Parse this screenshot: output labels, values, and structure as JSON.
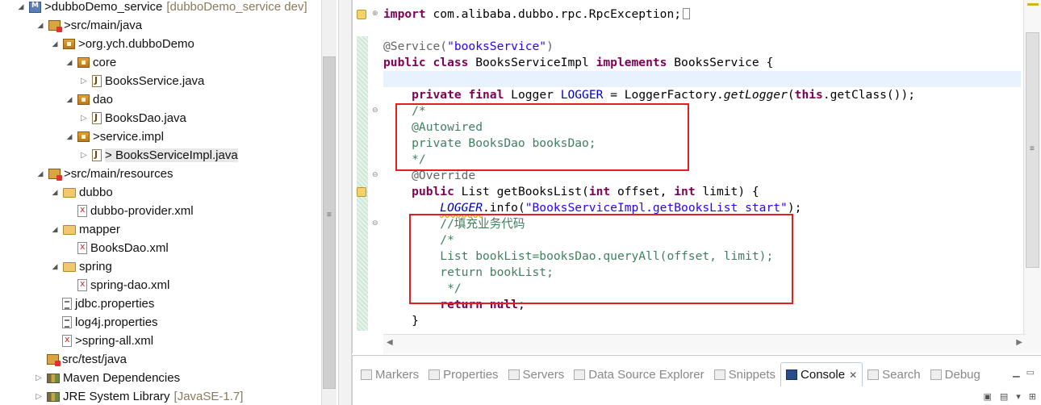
{
  "explorer": {
    "rows": [
      {
        "label": "dubboDemo_service",
        "prefix": "> ",
        "suffix": "[dubboDemo_service dev]",
        "icon": "project-icon",
        "expanded": true
      },
      {
        "label": "src/main/java",
        "prefix": "> ",
        "icon": "source-folder-icon",
        "expanded": true
      },
      {
        "label": "org.ych.dubboDemo",
        "prefix": "> ",
        "icon": "package-icon",
        "expanded": true
      },
      {
        "label": "core",
        "prefix": "",
        "icon": "package-icon",
        "expanded": true
      },
      {
        "label": "BooksService.java",
        "prefix": "",
        "icon": "java-file-icon",
        "expanded": false
      },
      {
        "label": "dao",
        "prefix": "",
        "icon": "package-icon",
        "expanded": true
      },
      {
        "label": "BooksDao.java",
        "prefix": "",
        "icon": "java-file-icon",
        "expanded": false
      },
      {
        "label": "service.impl",
        "prefix": "> ",
        "icon": "package-icon",
        "expanded": true
      },
      {
        "label": "BooksServiceImpl.java",
        "prefix": "> ",
        "icon": "java-file-icon",
        "expanded": false
      },
      {
        "label": "src/main/resources",
        "prefix": "> ",
        "icon": "source-folder-icon",
        "expanded": true
      },
      {
        "label": "dubbo",
        "prefix": "",
        "icon": "folder-icon",
        "expanded": true
      },
      {
        "label": "dubbo-provider.xml",
        "prefix": "",
        "icon": "xml-file-icon"
      },
      {
        "label": "mapper",
        "prefix": "",
        "icon": "folder-icon",
        "expanded": true
      },
      {
        "label": "BooksDao.xml",
        "prefix": "",
        "icon": "xml-file-icon"
      },
      {
        "label": "spring",
        "prefix": "",
        "icon": "folder-icon",
        "expanded": true
      },
      {
        "label": "spring-dao.xml",
        "prefix": "",
        "icon": "xml-file-icon"
      },
      {
        "label": "jdbc.properties",
        "prefix": "",
        "icon": "properties-file-icon"
      },
      {
        "label": "log4j.properties",
        "prefix": "",
        "icon": "properties-file-icon"
      },
      {
        "label": "spring-all.xml",
        "prefix": "> ",
        "icon": "xml-file-icon"
      },
      {
        "label": "src/test/java",
        "prefix": "",
        "icon": "source-folder-icon"
      },
      {
        "label": "Maven Dependencies",
        "prefix": "",
        "icon": "library-icon",
        "expanded": false
      },
      {
        "label": "JRE System Library",
        "prefix": "",
        "suffix": "[JavaSE-1.7]",
        "icon": "library-icon",
        "expanded": false
      }
    ]
  },
  "editor": {
    "lines": [
      {
        "import_kw": "import",
        "import_rest": " com.alibaba.dubbo.rpc.RpcException;"
      },
      {},
      {
        "ann": "@Service(",
        "str": "\"booksService\"",
        "ann2": ")"
      },
      {
        "kw1": "public class",
        "t1": " BooksServiceImpl ",
        "kw2": "implements",
        "t2": " BooksService {"
      },
      {},
      {
        "indent": "    ",
        "kw": "private final",
        "t1": " Logger ",
        "fld": "LOGGER",
        "t2": " = LoggerFactory.",
        "it": "getLogger",
        "t3": "(",
        "kw2": "this",
        "t4": ".getClass());"
      },
      {
        "cm": "    /*"
      },
      {
        "cm": "    @Autowired"
      },
      {
        "cm": "    private BooksDao booksDao;"
      },
      {
        "cm": "    */"
      },
      {
        "ann": "    @Override"
      },
      {
        "indent": "    ",
        "kw": "public",
        "t1": " List getBooksList(",
        "kw2": "int",
        "t2": " offset, ",
        "kw3": "int",
        "t3": " limit) {"
      },
      {
        "indent": "        ",
        "fld": "LOGGER",
        "t1": ".info(",
        "str": "\"BooksServiceImpl.getBooksList start\"",
        "t2": ");"
      },
      {
        "cm": "        //填充业务代码"
      },
      {
        "cm": "        /*"
      },
      {
        "cm": "        List bookList=booksDao.queryAll(offset, limit);"
      },
      {
        "cm": "        return bookList;"
      },
      {
        "cm": "         */"
      },
      {
        "indent": "        ",
        "kw": "return null",
        "t1": ";"
      },
      {
        "t1": "    }"
      }
    ]
  },
  "panel": {
    "tabs": [
      {
        "label": "Markers",
        "icon": "markers-icon"
      },
      {
        "label": "Properties",
        "icon": "properties-icon"
      },
      {
        "label": "Servers",
        "icon": "servers-icon"
      },
      {
        "label": "Data Source Explorer",
        "icon": "data-source-icon"
      },
      {
        "label": "Snippets",
        "icon": "snippets-icon"
      },
      {
        "label": "Console",
        "icon": "console-icon",
        "active": true,
        "close": "✕"
      },
      {
        "label": "Search",
        "icon": "search-icon"
      },
      {
        "label": "Debug",
        "icon": "debug-icon"
      }
    ]
  },
  "colors": {
    "keyword": "#7f0055",
    "string": "#2a00ff",
    "comment": "#3f7f5f",
    "annotation": "#646464",
    "field": "#0000c0",
    "highlight_box": "#e02020"
  }
}
